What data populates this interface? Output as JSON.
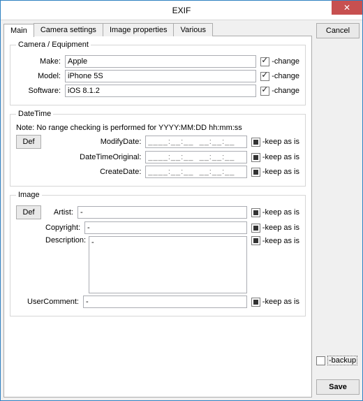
{
  "title": "EXIF",
  "tabs": [
    {
      "label": "Main",
      "active": true
    },
    {
      "label": "Camera settings",
      "active": false
    },
    {
      "label": "Image properties",
      "active": false
    },
    {
      "label": "Various",
      "active": false
    }
  ],
  "camera": {
    "legend": "Camera / Equipment",
    "make_label": "Make:",
    "make_value": "Apple",
    "model_label": "Model:",
    "model_value": "iPhone 5S",
    "software_label": "Software:",
    "software_value": "iOS 8.1.2",
    "change_label": "-change",
    "make_change": true,
    "model_change": true,
    "software_change": true
  },
  "datetime": {
    "legend": "DateTime",
    "note": "Note: No range checking is performed for YYYY:MM:DD hh:mm:ss",
    "def_label": "Def",
    "modify_label": "ModifyDate:",
    "original_label": "DateTimeOriginal:",
    "create_label": "CreateDate:",
    "placeholder": "____:__:__  __:__:__",
    "keep_label": "-keep as is",
    "modify_keep": true,
    "original_keep": true,
    "create_keep": true
  },
  "image": {
    "legend": "Image",
    "def_label": "Def",
    "artist_label": "Artist:",
    "artist_value": "-",
    "copyright_label": "Copyright:",
    "copyright_value": "-",
    "description_label": "Description:",
    "description_value": "-",
    "usercomment_label": "UserComment:",
    "usercomment_value": "-",
    "keep_label": "-keep as is",
    "artist_keep": true,
    "copyright_keep": true,
    "description_keep": true,
    "usercomment_keep": true
  },
  "side": {
    "cancel_label": "Cancel",
    "backup_label": "-backup",
    "backup_checked": false,
    "save_label": "Save"
  }
}
